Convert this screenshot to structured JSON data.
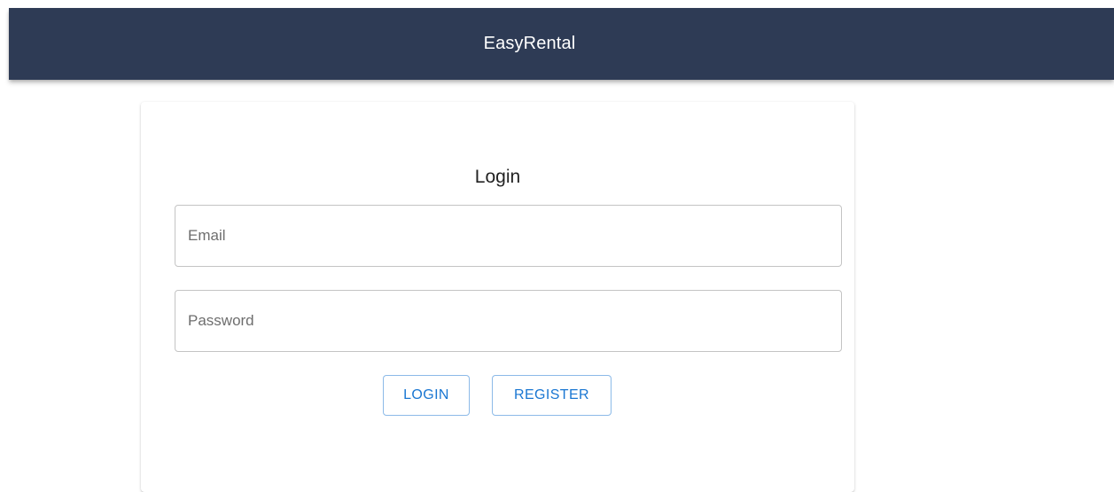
{
  "header": {
    "title": "EasyRental",
    "background": "#2e3b55"
  },
  "login_form": {
    "title": "Login",
    "email": {
      "placeholder": "Email",
      "value": ""
    },
    "password": {
      "placeholder": "Password",
      "value": ""
    },
    "buttons": {
      "login_label": "LOGIN",
      "register_label": "REGISTER"
    },
    "accent_color": "#1976d2"
  }
}
